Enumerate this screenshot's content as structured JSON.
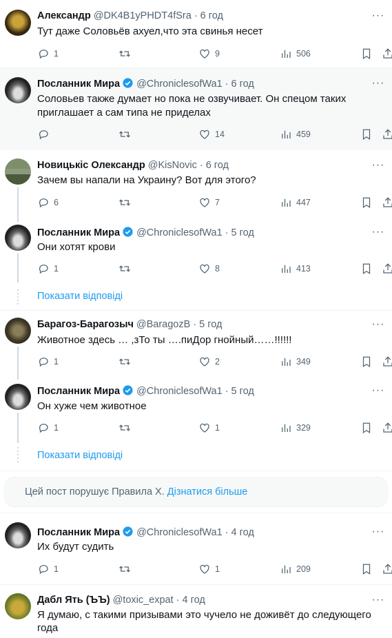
{
  "tweets": [
    {
      "name": "Александр",
      "handle": "@DK4B1yPHDT4fSra",
      "time": "· 6 год",
      "text": "Тут даже Соловьёв ахуел,что эта свинья несет",
      "replies": "1",
      "retweets": "",
      "likes": "9",
      "views": "506",
      "verified": false
    },
    {
      "name": "Посланник Мира",
      "handle": "@ChroniclesofWa1",
      "time": "· 6 год",
      "text": "Соловьев также думает но пока не озвучивает. Он спецом таких приглашает а сам типа не приделах",
      "replies": "",
      "retweets": "",
      "likes": "14",
      "views": "459",
      "verified": true
    },
    {
      "name": "Новицькіс Олександр",
      "handle": "@KisNovic",
      "time": "· 6 год",
      "text": "Зачем вы напали на Украину? Вот для этого?",
      "replies": "6",
      "retweets": "",
      "likes": "7",
      "views": "447",
      "verified": false
    },
    {
      "name": "Посланник Мира",
      "handle": "@ChroniclesofWa1",
      "time": "· 5 год",
      "text": "Они хотят крови",
      "replies": "1",
      "retweets": "",
      "likes": "8",
      "views": "413",
      "verified": true
    },
    {
      "name": "Барагоз-Барагозыч",
      "handle": "@BaragozB",
      "time": "· 5 год",
      "text": "Животное здесь … ,зТо ты ….пиДор гнойный……!!!!!!",
      "replies": "1",
      "retweets": "",
      "likes": "2",
      "views": "349",
      "verified": false
    },
    {
      "name": "Посланник Мира",
      "handle": "@ChroniclesofWa1",
      "time": "· 5 год",
      "text": "Он хуже чем животное",
      "replies": "1",
      "retweets": "",
      "likes": "1",
      "views": "329",
      "verified": true
    },
    {
      "name": "Посланник Мира",
      "handle": "@ChroniclesofWa1",
      "time": "· 4 год",
      "text": "Их будут судить",
      "replies": "1",
      "retweets": "",
      "likes": "1",
      "views": "209",
      "verified": true
    },
    {
      "name": "Дабл Ять (ЪЪ)",
      "handle": "@toxic_expat",
      "time": "· 4 год",
      "text": "Я думаю, с такими призывами это чучело не доживёт до следующего года",
      "verified": false
    }
  ],
  "show_replies_label": "Показати відповіді",
  "notice": {
    "text": "Цей пост порушує Правила X.",
    "link": "Дізнатися більше"
  },
  "icons": {
    "reply": "reply-icon",
    "retweet": "retweet-icon",
    "like": "heart-icon",
    "views": "views-icon",
    "bookmark": "bookmark-icon",
    "share": "share-icon",
    "more": "more-icon",
    "verified": "verified-badge-icon"
  },
  "colors": {
    "accent": "#1d9bf0",
    "muted": "#536471",
    "text": "#0f1419",
    "highlight_bg": "#f7f9f9"
  }
}
